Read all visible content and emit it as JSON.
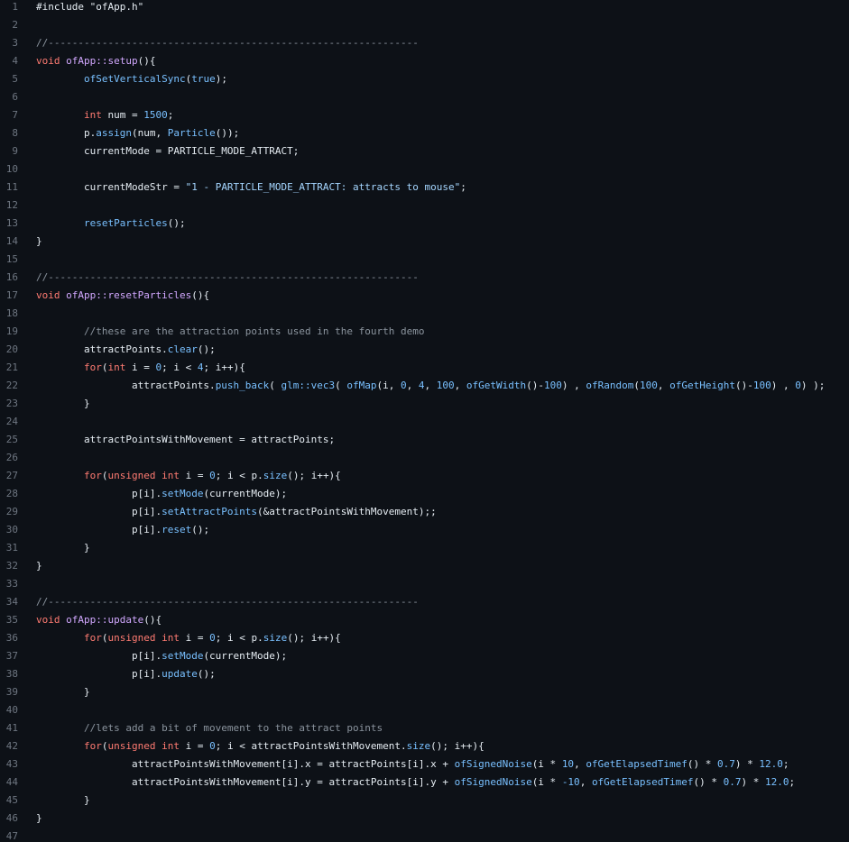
{
  "colors": {
    "background": "#0d1117",
    "line_number": "#6e7681",
    "plain": "#e6edf3",
    "keyword": "#ff7b72",
    "function": "#d2a8ff",
    "call": "#79c0ff",
    "number": "#79c0ff",
    "string": "#a5d6ff",
    "comment": "#8b949e"
  },
  "lines": [
    {
      "n": "1",
      "tokens": [
        {
          "t": "#include \"ofApp.h\"",
          "c": "plain"
        }
      ]
    },
    {
      "n": "2",
      "tokens": []
    },
    {
      "n": "3",
      "tokens": [
        {
          "t": "//--------------------------------------------------------------",
          "c": "comment"
        }
      ]
    },
    {
      "n": "4",
      "tokens": [
        {
          "t": "void ",
          "c": "keyword"
        },
        {
          "t": "ofApp::",
          "c": "func"
        },
        {
          "t": "setup",
          "c": "func"
        },
        {
          "t": "(){",
          "c": "plain"
        }
      ]
    },
    {
      "n": "5",
      "tokens": [
        {
          "t": "        ",
          "c": "plain"
        },
        {
          "t": "ofSetVerticalSync",
          "c": "call"
        },
        {
          "t": "(",
          "c": "plain"
        },
        {
          "t": "true",
          "c": "number"
        },
        {
          "t": ");",
          "c": "plain"
        }
      ]
    },
    {
      "n": "6",
      "tokens": []
    },
    {
      "n": "7",
      "tokens": [
        {
          "t": "        ",
          "c": "plain"
        },
        {
          "t": "int",
          "c": "keyword"
        },
        {
          "t": " num = ",
          "c": "plain"
        },
        {
          "t": "1500",
          "c": "number"
        },
        {
          "t": ";",
          "c": "plain"
        }
      ]
    },
    {
      "n": "8",
      "tokens": [
        {
          "t": "        p.",
          "c": "plain"
        },
        {
          "t": "assign",
          "c": "call"
        },
        {
          "t": "(num, ",
          "c": "plain"
        },
        {
          "t": "Particle",
          "c": "call"
        },
        {
          "t": "());",
          "c": "plain"
        }
      ]
    },
    {
      "n": "9",
      "tokens": [
        {
          "t": "        currentMode = PARTICLE_MODE_ATTRACT;",
          "c": "plain"
        }
      ]
    },
    {
      "n": "10",
      "tokens": []
    },
    {
      "n": "11",
      "tokens": [
        {
          "t": "        currentModeStr = ",
          "c": "plain"
        },
        {
          "t": "\"1 - PARTICLE_MODE_ATTRACT: attracts to mouse\"",
          "c": "string"
        },
        {
          "t": ";",
          "c": "plain"
        }
      ]
    },
    {
      "n": "12",
      "tokens": []
    },
    {
      "n": "13",
      "tokens": [
        {
          "t": "        ",
          "c": "plain"
        },
        {
          "t": "resetParticles",
          "c": "call"
        },
        {
          "t": "();",
          "c": "plain"
        }
      ]
    },
    {
      "n": "14",
      "tokens": [
        {
          "t": "}",
          "c": "plain"
        }
      ]
    },
    {
      "n": "15",
      "tokens": []
    },
    {
      "n": "16",
      "tokens": [
        {
          "t": "//--------------------------------------------------------------",
          "c": "comment"
        }
      ]
    },
    {
      "n": "17",
      "tokens": [
        {
          "t": "void ",
          "c": "keyword"
        },
        {
          "t": "ofApp::",
          "c": "func"
        },
        {
          "t": "resetParticles",
          "c": "func"
        },
        {
          "t": "(){",
          "c": "plain"
        }
      ]
    },
    {
      "n": "18",
      "tokens": []
    },
    {
      "n": "19",
      "tokens": [
        {
          "t": "        ",
          "c": "plain"
        },
        {
          "t": "//these are the attraction points used in the fourth demo",
          "c": "comment"
        }
      ]
    },
    {
      "n": "20",
      "tokens": [
        {
          "t": "        attractPoints.",
          "c": "plain"
        },
        {
          "t": "clear",
          "c": "call"
        },
        {
          "t": "();",
          "c": "plain"
        }
      ]
    },
    {
      "n": "21",
      "tokens": [
        {
          "t": "        ",
          "c": "plain"
        },
        {
          "t": "for",
          "c": "keyword"
        },
        {
          "t": "(",
          "c": "plain"
        },
        {
          "t": "int",
          "c": "keyword"
        },
        {
          "t": " i = ",
          "c": "plain"
        },
        {
          "t": "0",
          "c": "number"
        },
        {
          "t": "; i < ",
          "c": "plain"
        },
        {
          "t": "4",
          "c": "number"
        },
        {
          "t": "; i++){",
          "c": "plain"
        }
      ]
    },
    {
      "n": "22",
      "tokens": [
        {
          "t": "                attractPoints.",
          "c": "plain"
        },
        {
          "t": "push_back",
          "c": "call"
        },
        {
          "t": "( ",
          "c": "plain"
        },
        {
          "t": "glm::vec3",
          "c": "call"
        },
        {
          "t": "( ",
          "c": "plain"
        },
        {
          "t": "ofMap",
          "c": "call"
        },
        {
          "t": "(i, ",
          "c": "plain"
        },
        {
          "t": "0",
          "c": "number"
        },
        {
          "t": ", ",
          "c": "plain"
        },
        {
          "t": "4",
          "c": "number"
        },
        {
          "t": ", ",
          "c": "plain"
        },
        {
          "t": "100",
          "c": "number"
        },
        {
          "t": ", ",
          "c": "plain"
        },
        {
          "t": "ofGetWidth",
          "c": "call"
        },
        {
          "t": "()-",
          "c": "plain"
        },
        {
          "t": "100",
          "c": "number"
        },
        {
          "t": ") , ",
          "c": "plain"
        },
        {
          "t": "ofRandom",
          "c": "call"
        },
        {
          "t": "(",
          "c": "plain"
        },
        {
          "t": "100",
          "c": "number"
        },
        {
          "t": ", ",
          "c": "plain"
        },
        {
          "t": "ofGetHeight",
          "c": "call"
        },
        {
          "t": "()-",
          "c": "plain"
        },
        {
          "t": "100",
          "c": "number"
        },
        {
          "t": ") , ",
          "c": "plain"
        },
        {
          "t": "0",
          "c": "number"
        },
        {
          "t": ") );",
          "c": "plain"
        }
      ]
    },
    {
      "n": "23",
      "tokens": [
        {
          "t": "        }",
          "c": "plain"
        }
      ]
    },
    {
      "n": "24",
      "tokens": []
    },
    {
      "n": "25",
      "tokens": [
        {
          "t": "        attractPointsWithMovement = attractPoints;",
          "c": "plain"
        }
      ]
    },
    {
      "n": "26",
      "tokens": []
    },
    {
      "n": "27",
      "tokens": [
        {
          "t": "        ",
          "c": "plain"
        },
        {
          "t": "for",
          "c": "keyword"
        },
        {
          "t": "(",
          "c": "plain"
        },
        {
          "t": "unsigned int",
          "c": "keyword"
        },
        {
          "t": " i = ",
          "c": "plain"
        },
        {
          "t": "0",
          "c": "number"
        },
        {
          "t": "; i < p.",
          "c": "plain"
        },
        {
          "t": "size",
          "c": "call"
        },
        {
          "t": "(); i++){",
          "c": "plain"
        }
      ]
    },
    {
      "n": "28",
      "tokens": [
        {
          "t": "                p[i].",
          "c": "plain"
        },
        {
          "t": "setMode",
          "c": "call"
        },
        {
          "t": "(currentMode);",
          "c": "plain"
        }
      ]
    },
    {
      "n": "29",
      "tokens": [
        {
          "t": "                p[i].",
          "c": "plain"
        },
        {
          "t": "setAttractPoints",
          "c": "call"
        },
        {
          "t": "(&attractPointsWithMovement);;",
          "c": "plain"
        }
      ]
    },
    {
      "n": "30",
      "tokens": [
        {
          "t": "                p[i].",
          "c": "plain"
        },
        {
          "t": "reset",
          "c": "call"
        },
        {
          "t": "();",
          "c": "plain"
        }
      ]
    },
    {
      "n": "31",
      "tokens": [
        {
          "t": "        }",
          "c": "plain"
        }
      ]
    },
    {
      "n": "32",
      "tokens": [
        {
          "t": "}",
          "c": "plain"
        }
      ]
    },
    {
      "n": "33",
      "tokens": []
    },
    {
      "n": "34",
      "tokens": [
        {
          "t": "//--------------------------------------------------------------",
          "c": "comment"
        }
      ]
    },
    {
      "n": "35",
      "tokens": [
        {
          "t": "void ",
          "c": "keyword"
        },
        {
          "t": "ofApp::",
          "c": "func"
        },
        {
          "t": "update",
          "c": "func"
        },
        {
          "t": "(){",
          "c": "plain"
        }
      ]
    },
    {
      "n": "36",
      "tokens": [
        {
          "t": "        ",
          "c": "plain"
        },
        {
          "t": "for",
          "c": "keyword"
        },
        {
          "t": "(",
          "c": "plain"
        },
        {
          "t": "unsigned int",
          "c": "keyword"
        },
        {
          "t": " i = ",
          "c": "plain"
        },
        {
          "t": "0",
          "c": "number"
        },
        {
          "t": "; i < p.",
          "c": "plain"
        },
        {
          "t": "size",
          "c": "call"
        },
        {
          "t": "(); i++){",
          "c": "plain"
        }
      ]
    },
    {
      "n": "37",
      "tokens": [
        {
          "t": "                p[i].",
          "c": "plain"
        },
        {
          "t": "setMode",
          "c": "call"
        },
        {
          "t": "(currentMode);",
          "c": "plain"
        }
      ]
    },
    {
      "n": "38",
      "tokens": [
        {
          "t": "                p[i].",
          "c": "plain"
        },
        {
          "t": "update",
          "c": "call"
        },
        {
          "t": "();",
          "c": "plain"
        }
      ]
    },
    {
      "n": "39",
      "tokens": [
        {
          "t": "        }",
          "c": "plain"
        }
      ]
    },
    {
      "n": "40",
      "tokens": []
    },
    {
      "n": "41",
      "tokens": [
        {
          "t": "        ",
          "c": "plain"
        },
        {
          "t": "//lets add a bit of movement to the attract points",
          "c": "comment"
        }
      ]
    },
    {
      "n": "42",
      "tokens": [
        {
          "t": "        ",
          "c": "plain"
        },
        {
          "t": "for",
          "c": "keyword"
        },
        {
          "t": "(",
          "c": "plain"
        },
        {
          "t": "unsigned int",
          "c": "keyword"
        },
        {
          "t": " i = ",
          "c": "plain"
        },
        {
          "t": "0",
          "c": "number"
        },
        {
          "t": "; i < attractPointsWithMovement.",
          "c": "plain"
        },
        {
          "t": "size",
          "c": "call"
        },
        {
          "t": "(); i++){",
          "c": "plain"
        }
      ]
    },
    {
      "n": "43",
      "tokens": [
        {
          "t": "                attractPointsWithMovement[i].x = attractPoints[i].x + ",
          "c": "plain"
        },
        {
          "t": "ofSignedNoise",
          "c": "call"
        },
        {
          "t": "(i * ",
          "c": "plain"
        },
        {
          "t": "10",
          "c": "number"
        },
        {
          "t": ", ",
          "c": "plain"
        },
        {
          "t": "ofGetElapsedTimef",
          "c": "call"
        },
        {
          "t": "() * ",
          "c": "plain"
        },
        {
          "t": "0.7",
          "c": "number"
        },
        {
          "t": ") * ",
          "c": "plain"
        },
        {
          "t": "12.0",
          "c": "number"
        },
        {
          "t": ";",
          "c": "plain"
        }
      ]
    },
    {
      "n": "44",
      "tokens": [
        {
          "t": "                attractPointsWithMovement[i].y = attractPoints[i].y + ",
          "c": "plain"
        },
        {
          "t": "ofSignedNoise",
          "c": "call"
        },
        {
          "t": "(i * ",
          "c": "plain"
        },
        {
          "t": "-10",
          "c": "number"
        },
        {
          "t": ", ",
          "c": "plain"
        },
        {
          "t": "ofGetElapsedTimef",
          "c": "call"
        },
        {
          "t": "() * ",
          "c": "plain"
        },
        {
          "t": "0.7",
          "c": "number"
        },
        {
          "t": ") * ",
          "c": "plain"
        },
        {
          "t": "12.0",
          "c": "number"
        },
        {
          "t": ";",
          "c": "plain"
        }
      ]
    },
    {
      "n": "45",
      "tokens": [
        {
          "t": "        }",
          "c": "plain"
        }
      ]
    },
    {
      "n": "46",
      "tokens": [
        {
          "t": "}",
          "c": "plain"
        }
      ]
    },
    {
      "n": "47",
      "tokens": []
    }
  ]
}
